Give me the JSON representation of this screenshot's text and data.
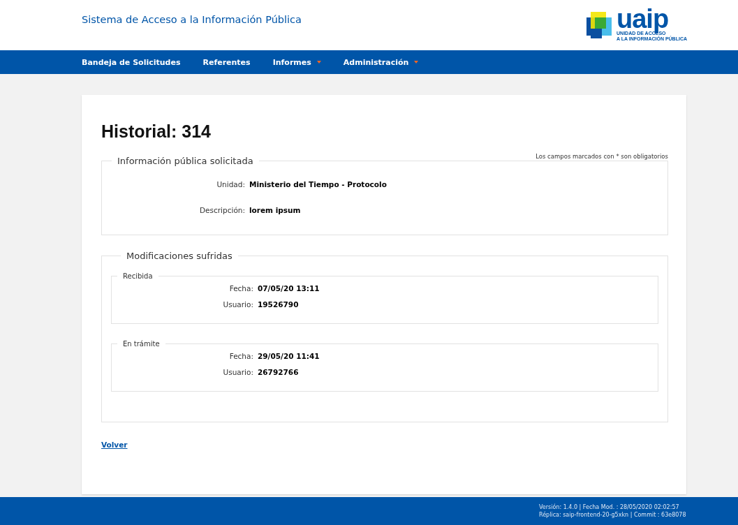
{
  "header": {
    "title": "Sistema de Acceso a la Información Pública",
    "logo": {
      "word": "uaip",
      "line_1": "UNIDAD DE ACCESO",
      "line_2": "A LA INFORMACIÓN PÚBLICA"
    }
  },
  "nav": [
    {
      "label": "Bandeja de Solicitudes",
      "dropdown": false
    },
    {
      "label": "Referentes",
      "dropdown": false
    },
    {
      "label": "Informes",
      "dropdown": true
    },
    {
      "label": "Administración",
      "dropdown": true
    }
  ],
  "page": {
    "title": "Historial: 314",
    "required_note": "Los campos marcados con * son obligatorios",
    "info": {
      "legend": "Información pública solicitada",
      "fields": [
        {
          "label": "Unidad:",
          "value": "Ministerio del Tiempo - Protocolo"
        },
        {
          "label": "Descripción:",
          "value": "lorem ipsum"
        }
      ]
    },
    "modifications": {
      "legend": "Modificaciones sufridas",
      "entries": [
        {
          "legend": "Recibida",
          "fields": [
            {
              "label": "Fecha:",
              "value": "07/05/20 13:11"
            },
            {
              "label": "Usuario:",
              "value": "19526790"
            }
          ]
        },
        {
          "legend": "En trámite",
          "fields": [
            {
              "label": "Fecha:",
              "value": "29/05/20 11:41"
            },
            {
              "label": "Usuario:",
              "value": "26792766"
            }
          ]
        }
      ]
    },
    "back_link": "Volver"
  },
  "footer": {
    "line_1": "Versión: 1.4.0 | Fecha Mod. : 28/05/2020 02:02:57",
    "line_2": "Réplica: saip-frontend-20-g5xkn | Commit : 63e8078"
  }
}
